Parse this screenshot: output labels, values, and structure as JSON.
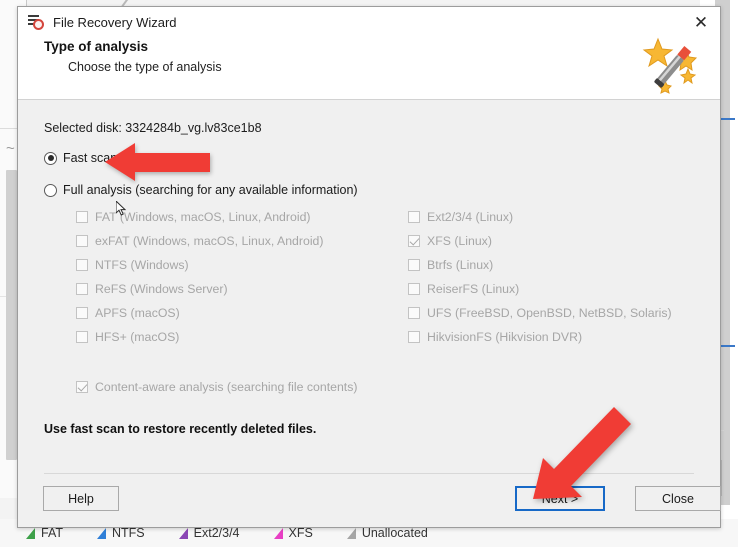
{
  "window": {
    "title": "File Recovery Wizard",
    "icon": "disk-stack-red-ring-icon",
    "close_label": "✕"
  },
  "header": {
    "title": "Type of analysis",
    "subtitle": "Choose the type of analysis",
    "icon": "magic-wand-stars-icon"
  },
  "main": {
    "selected_disk": "Selected disk: 3324284b_vg.lv83ce1b8",
    "scan_modes": [
      {
        "label": "Fast scan",
        "selected": true
      },
      {
        "label": "Full analysis (searching for any available information)",
        "selected": false
      }
    ],
    "filesystems_left": [
      {
        "label": "FAT (Windows, macOS, Linux, Android)",
        "checked": false,
        "enabled": false
      },
      {
        "label": "exFAT (Windows, macOS, Linux, Android)",
        "checked": false,
        "enabled": false
      },
      {
        "label": "NTFS (Windows)",
        "checked": false,
        "enabled": false
      },
      {
        "label": "ReFS (Windows Server)",
        "checked": false,
        "enabled": false
      },
      {
        "label": "APFS (macOS)",
        "checked": false,
        "enabled": false
      },
      {
        "label": "HFS+ (macOS)",
        "checked": false,
        "enabled": false
      }
    ],
    "filesystems_right": [
      {
        "label": "Ext2/3/4 (Linux)",
        "checked": false,
        "enabled": false
      },
      {
        "label": "XFS (Linux)",
        "checked": true,
        "enabled": false
      },
      {
        "label": "Btrfs (Linux)",
        "checked": false,
        "enabled": false
      },
      {
        "label": "ReiserFS (Linux)",
        "checked": false,
        "enabled": false
      },
      {
        "label": "UFS (FreeBSD, OpenBSD, NetBSD, Solaris)",
        "checked": false,
        "enabled": false
      },
      {
        "label": "HikvisionFS (Hikvision DVR)",
        "checked": false,
        "enabled": false
      }
    ],
    "content_aware": {
      "label": "Content-aware analysis (searching file contents)",
      "checked": true,
      "enabled": false
    },
    "hint": "Use fast scan to restore recently deleted files."
  },
  "footer": {
    "help_label": "Help",
    "next_label": "Next >",
    "close_label": "Close"
  },
  "legend": [
    {
      "label": "FAT",
      "color": "#3ea14a"
    },
    {
      "label": "NTFS",
      "color": "#2f7fd8"
    },
    {
      "label": "Ext2/3/4",
      "color": "#8b46b5"
    },
    {
      "label": "XFS",
      "color": "#e83fc4"
    },
    {
      "label": "Unallocated",
      "color": "#a6a6a6"
    }
  ],
  "annotations": {
    "arrow_left": "red-arrow-pointing-left-at-fast-scan",
    "arrow_diagonal": "red-arrow-pointing-down-left-at-next-button",
    "accent_color": "#f03c35",
    "focus_color": "#1769c7"
  }
}
